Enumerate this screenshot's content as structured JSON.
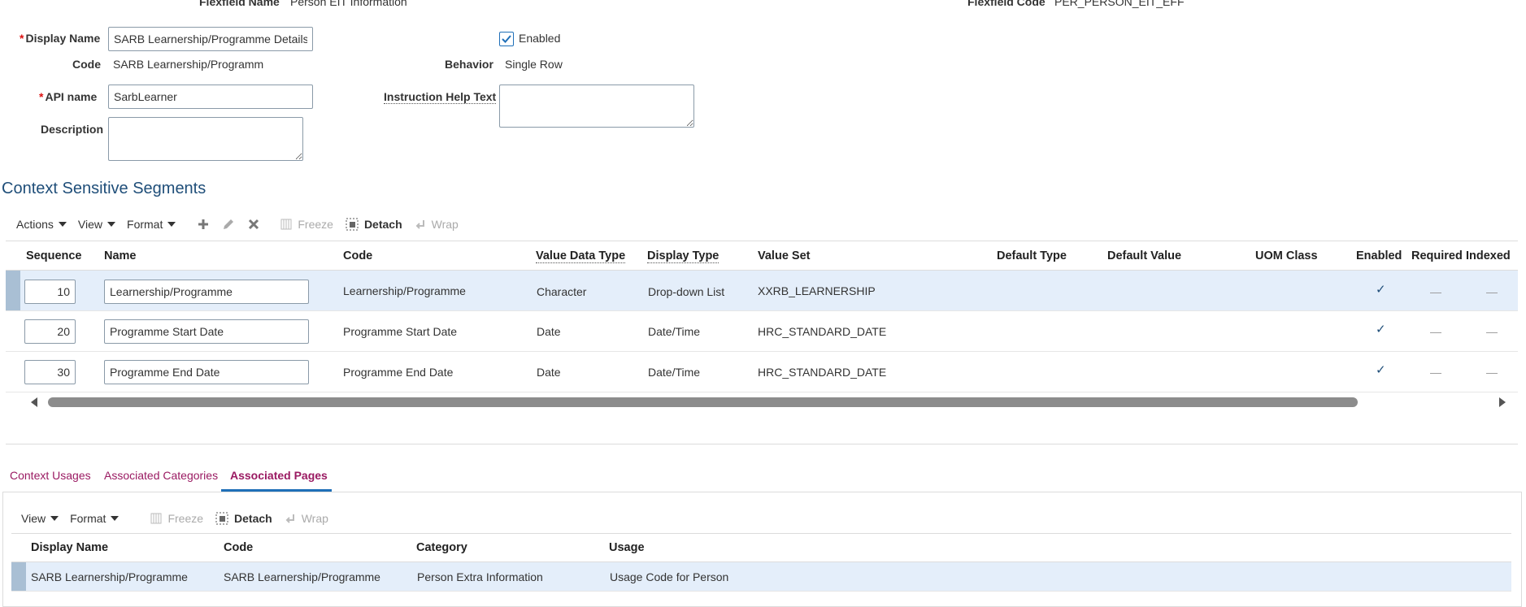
{
  "header": {
    "flexfield_name_label": "Flexfield Name",
    "flexfield_name_value": "Person EIT Information",
    "flexfield_code_label": "Flexfield Code",
    "flexfield_code_value": "PER_PERSON_EIT_EFF"
  },
  "form": {
    "required_mark": "*",
    "display_name_label": "Display Name",
    "display_name_value": "SARB Learnership/Programme Details",
    "enabled_label": "Enabled",
    "enabled_checked": true,
    "code_label": "Code",
    "code_value": "SARB Learnership/Programm",
    "behavior_label": "Behavior",
    "behavior_value": "Single Row",
    "api_name_label": "API name",
    "api_name_value": "SarbLearner",
    "instruction_help_label": "Instruction Help Text",
    "instruction_help_value": "",
    "description_label": "Description",
    "description_value": ""
  },
  "segments": {
    "title": "Context Sensitive Segments",
    "toolbar": {
      "actions": "Actions",
      "view": "View",
      "format": "Format",
      "freeze": "Freeze",
      "detach": "Detach",
      "wrap": "Wrap"
    },
    "columns": {
      "sequence": "Sequence",
      "name": "Name",
      "code": "Code",
      "value_data_type": "Value Data Type",
      "display_type": "Display Type",
      "value_set": "Value Set",
      "default_type": "Default Type",
      "default_value": "Default Value",
      "uom_class": "UOM Class",
      "enabled": "Enabled",
      "required": "Required",
      "indexed": "Indexed"
    },
    "rows": [
      {
        "sequence": "10",
        "name": "Learnership/Programme",
        "code": "Learnership/Programme",
        "value_data_type": "Character",
        "display_type": "Drop-down List",
        "value_set": "XXRB_LEARNERSHIP",
        "enabled": "✓",
        "required": "—",
        "indexed": "—"
      },
      {
        "sequence": "20",
        "name": "Programme Start Date",
        "code": "Programme Start Date",
        "value_data_type": "Date",
        "display_type": "Date/Time",
        "value_set": "HRC_STANDARD_DATE",
        "enabled": "✓",
        "required": "—",
        "indexed": "—"
      },
      {
        "sequence": "30",
        "name": "Programme End Date",
        "code": "Programme End Date",
        "value_data_type": "Date",
        "display_type": "Date/Time",
        "value_set": "HRC_STANDARD_DATE",
        "enabled": "✓",
        "required": "—",
        "indexed": "—"
      }
    ]
  },
  "tabs": {
    "context_usages": "Context Usages",
    "associated_categories": "Associated Categories",
    "associated_pages": "Associated Pages"
  },
  "pages": {
    "toolbar": {
      "view": "View",
      "format": "Format",
      "freeze": "Freeze",
      "detach": "Detach",
      "wrap": "Wrap"
    },
    "columns": {
      "display_name": "Display Name",
      "code": "Code",
      "category": "Category",
      "usage": "Usage"
    },
    "rows": [
      {
        "display_name": "SARB Learnership/Programme",
        "code": "SARB Learnership/Programme",
        "category": "Person Extra Information",
        "usage": "Usage Code for Person"
      }
    ]
  },
  "colors": {
    "accent": "#1f4e79",
    "tab": "#9a1a62",
    "selected_row": "#e4eefa"
  }
}
